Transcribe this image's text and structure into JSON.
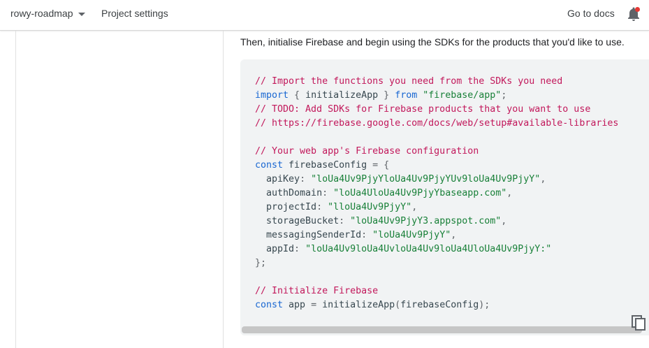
{
  "header": {
    "project_name": "rowy-roadmap",
    "project_settings": "Project settings",
    "go_to_docs": "Go to docs"
  },
  "content": {
    "intro": "Then, initialise Firebase and begin using the SDKs for the products that you'd like to use."
  },
  "code": {
    "comment_import": "// Import the functions you need from the SDKs you need",
    "import_kw": "import",
    "import_brace_open": " { ",
    "import_name": "initializeApp",
    "import_brace_close": " } ",
    "from_kw": "from",
    "import_module": "\"firebase/app\"",
    "import_end": ";",
    "comment_todo": "// TODO: Add SDKs for Firebase products that you want to use",
    "comment_url": "// https://firebase.google.com/docs/web/setup#available-libraries",
    "comment_config": "// Your web app's Firebase configuration",
    "const_kw": "const",
    "config_name": " firebaseConfig ",
    "config_open": "= {",
    "fields": [
      {
        "key": "apiKey",
        "value": "\"loUa4Uv9PjyYloUa4Uv9PjyYUv9loUa4Uv9PjyY\""
      },
      {
        "key": "authDomain",
        "value": "\"loUa4UloUa4Uv9PjyYbaseapp.com\""
      },
      {
        "key": "projectId",
        "value": "\"lloUa4Uv9PjyY\""
      },
      {
        "key": "storageBucket",
        "value": "\"loUa4Uv9PjyY3.appspot.com\""
      },
      {
        "key": "messagingSenderId",
        "value": "\"loUa4Uv9PjyY\""
      },
      {
        "key": "appId",
        "value": "\"loUa4Uv9loUa4UvloUa4Uv9loUa4UloUa4Uv9PjyY:\""
      }
    ],
    "config_close": "};",
    "comment_init": "// Initialize Firebase",
    "app_name": " app ",
    "app_assign": "= ",
    "app_call": "initializeApp",
    "app_paren_open": "(",
    "app_arg": "firebaseConfig",
    "app_paren_close": ");"
  },
  "icons": {
    "bell": "notifications-bell-icon",
    "copy": "copy-icon",
    "dropdown": "chevron-down-icon"
  },
  "colors": {
    "comment": "#c2185b",
    "keyword": "#1967d2",
    "string": "#188038",
    "notification_dot": "#e53935"
  }
}
